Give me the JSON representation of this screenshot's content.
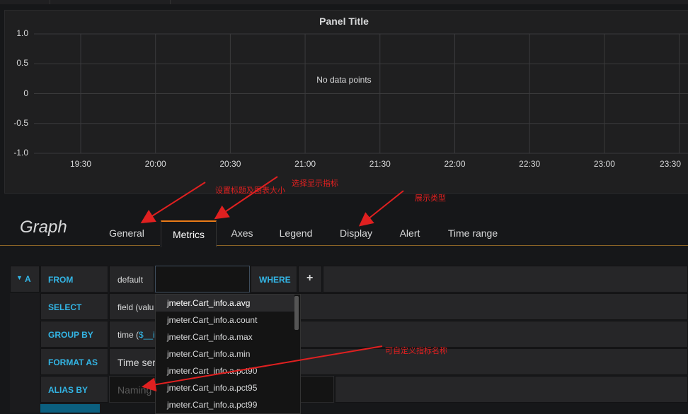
{
  "panel": {
    "title": "Panel Title",
    "no_data": "No data points"
  },
  "chart_data": {
    "type": "line",
    "title": "Panel Title",
    "x": [
      "19:30",
      "20:00",
      "20:30",
      "21:00",
      "21:30",
      "22:00",
      "22:30",
      "23:00",
      "23:30"
    ],
    "yticks": [
      "1.0",
      "0.5",
      "0",
      "-0.5",
      "-1.0"
    ],
    "ylim": [
      -1.0,
      1.0
    ],
    "series": [],
    "grid": true,
    "annotation": "No data points"
  },
  "editor": {
    "graph_title": "Graph",
    "tabs": [
      "General",
      "Metrics",
      "Axes",
      "Legend",
      "Display",
      "Alert",
      "Time range"
    ],
    "active_tab": "Metrics"
  },
  "query": {
    "ref": "A",
    "from_label": "FROM",
    "from_value": "default",
    "where_label": "WHERE",
    "plus": "+",
    "select_label": "SELECT",
    "select_value": "field (valu",
    "group_label": "GROUP BY",
    "group_value_prefix": "time (",
    "group_value_var": "$__i",
    "format_label": "FORMAT AS",
    "format_value": "Time ser",
    "alias_label": "ALIAS BY",
    "alias_placeholder": "Naming"
  },
  "dropdown": {
    "items": [
      "jmeter.Cart_info.a.avg",
      "jmeter.Cart_info.a.count",
      "jmeter.Cart_info.a.max",
      "jmeter.Cart_info.a.min",
      "jmeter.Cart_info.a.pct90",
      "jmeter.Cart_info.a.pct95",
      "jmeter.Cart_info.a.pct99"
    ]
  },
  "annotations": {
    "general": "设置标题及图表大小",
    "metrics": "选择显示指标",
    "display": "展示类型",
    "alias": "可自定义指标名称"
  },
  "colors": {
    "accent": "#eb7b18",
    "keyword": "#33b5e5",
    "annotation": "#e02020"
  }
}
